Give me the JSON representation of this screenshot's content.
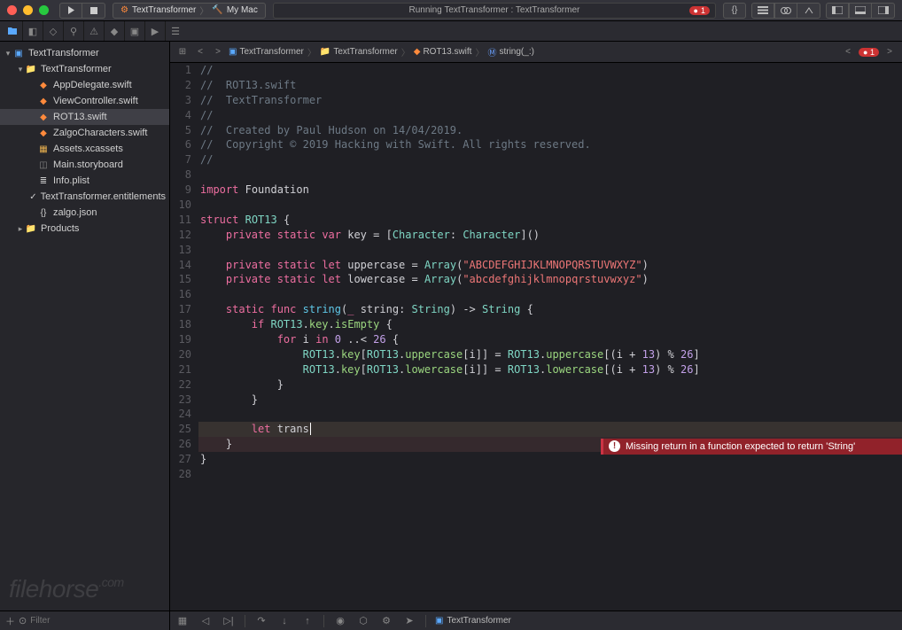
{
  "titlebar": {
    "scheme_target": "TextTransformer",
    "scheme_dest": "My Mac",
    "status_text": "Running TextTransformer : TextTransformer",
    "error_count": "1"
  },
  "navigator": {
    "items": [
      {
        "depth": 0,
        "disc": "▾",
        "icon": "proj",
        "label": "TextTransformer"
      },
      {
        "depth": 1,
        "disc": "▾",
        "icon": "folder",
        "label": "TextTransformer"
      },
      {
        "depth": 2,
        "disc": "",
        "icon": "swift",
        "label": "AppDelegate.swift"
      },
      {
        "depth": 2,
        "disc": "",
        "icon": "swift",
        "label": "ViewController.swift"
      },
      {
        "depth": 2,
        "disc": "",
        "icon": "swift",
        "label": "ROT13.swift",
        "selected": true
      },
      {
        "depth": 2,
        "disc": "",
        "icon": "swift",
        "label": "ZalgoCharacters.swift"
      },
      {
        "depth": 2,
        "disc": "",
        "icon": "asset",
        "label": "Assets.xcassets"
      },
      {
        "depth": 2,
        "disc": "",
        "icon": "sb",
        "label": "Main.storyboard"
      },
      {
        "depth": 2,
        "disc": "",
        "icon": "plist",
        "label": "Info.plist"
      },
      {
        "depth": 2,
        "disc": "",
        "icon": "ent",
        "label": "TextTransformer.entitlements"
      },
      {
        "depth": 2,
        "disc": "",
        "icon": "json",
        "label": "zalgo.json"
      },
      {
        "depth": 1,
        "disc": "▸",
        "icon": "folder",
        "label": "Products"
      }
    ]
  },
  "jumpbar": {
    "segments": [
      {
        "icon": "proj",
        "label": "TextTransformer"
      },
      {
        "icon": "folder",
        "label": "TextTransformer"
      },
      {
        "icon": "swift",
        "label": "ROT13.swift"
      },
      {
        "icon": "method",
        "label": "string(_:)"
      }
    ],
    "error_count": "1"
  },
  "code": {
    "lines": [
      {
        "n": 1,
        "t": "comment",
        "text": "//"
      },
      {
        "n": 2,
        "t": "comment",
        "text": "//  ROT13.swift"
      },
      {
        "n": 3,
        "t": "comment",
        "text": "//  TextTransformer"
      },
      {
        "n": 4,
        "t": "comment",
        "text": "//"
      },
      {
        "n": 5,
        "t": "comment",
        "text": "//  Created by Paul Hudson on 14/04/2019."
      },
      {
        "n": 6,
        "t": "comment",
        "text": "//  Copyright © 2019 Hacking with Swift. All rights reserved."
      },
      {
        "n": 7,
        "t": "comment",
        "text": "//"
      },
      {
        "n": 8,
        "t": "blank",
        "text": ""
      },
      {
        "n": 9,
        "t": "raw",
        "html": "<span class='cm-key'>import</span> <span class='cm-id'>Foundation</span>"
      },
      {
        "n": 10,
        "t": "blank",
        "text": ""
      },
      {
        "n": 11,
        "t": "raw",
        "html": "<span class='cm-key'>struct</span> <span class='cm-type'>ROT13</span> {"
      },
      {
        "n": 12,
        "t": "raw",
        "html": "    <span class='cm-key'>private</span> <span class='cm-key'>static</span> <span class='cm-key'>var</span> <span class='cm-id'>key</span> = [<span class='cm-type'>Character</span>: <span class='cm-type'>Character</span>]()"
      },
      {
        "n": 13,
        "t": "blank",
        "text": ""
      },
      {
        "n": 14,
        "t": "raw",
        "html": "    <span class='cm-key'>private</span> <span class='cm-key'>static</span> <span class='cm-key'>let</span> <span class='cm-id'>uppercase</span> = <span class='cm-type'>Array</span>(<span class='cm-str'>\"ABCDEFGHIJKLMNOPQRSTUVWXYZ\"</span>)"
      },
      {
        "n": 15,
        "t": "raw",
        "html": "    <span class='cm-key'>private</span> <span class='cm-key'>static</span> <span class='cm-key'>let</span> <span class='cm-id'>lowercase</span> = <span class='cm-type'>Array</span>(<span class='cm-str'>\"abcdefghijklmnopqrstuvwxyz\"</span>)"
      },
      {
        "n": 16,
        "t": "blank",
        "text": ""
      },
      {
        "n": 17,
        "t": "raw",
        "html": "    <span class='cm-key'>static</span> <span class='cm-key'>func</span> <span class='cm-func'>string</span>(<span class='cm-key'>_</span> <span class='cm-id'>string</span>: <span class='cm-type'>String</span>) -&gt; <span class='cm-type'>String</span> {"
      },
      {
        "n": 18,
        "t": "raw",
        "html": "        <span class='cm-key'>if</span> <span class='cm-type'>ROT13</span>.<span class='cm-prop'>key</span>.<span class='cm-prop'>isEmpty</span> {"
      },
      {
        "n": 19,
        "t": "raw",
        "html": "            <span class='cm-key'>for</span> <span class='cm-id'>i</span> <span class='cm-key'>in</span> <span class='cm-num'>0</span> ..&lt; <span class='cm-num'>26</span> {"
      },
      {
        "n": 20,
        "t": "raw",
        "html": "                <span class='cm-type'>ROT13</span>.<span class='cm-prop'>key</span>[<span class='cm-type'>ROT13</span>.<span class='cm-prop'>uppercase</span>[<span class='cm-id'>i</span>]] = <span class='cm-type'>ROT13</span>.<span class='cm-prop'>uppercase</span>[(<span class='cm-id'>i</span> + <span class='cm-num'>13</span>) % <span class='cm-num'>26</span>]"
      },
      {
        "n": 21,
        "t": "raw",
        "html": "                <span class='cm-type'>ROT13</span>.<span class='cm-prop'>key</span>[<span class='cm-type'>ROT13</span>.<span class='cm-prop'>lowercase</span>[<span class='cm-id'>i</span>]] = <span class='cm-type'>ROT13</span>.<span class='cm-prop'>lowercase</span>[(<span class='cm-id'>i</span> + <span class='cm-num'>13</span>) % <span class='cm-num'>26</span>]"
      },
      {
        "n": 22,
        "t": "raw",
        "html": "            }"
      },
      {
        "n": 23,
        "t": "raw",
        "html": "        }"
      },
      {
        "n": 24,
        "t": "blank",
        "text": ""
      },
      {
        "n": 25,
        "t": "raw",
        "hl": true,
        "html": "        <span class='cm-key'>let</span> <span class='cm-id'>trans</span><span class='cursor'></span>"
      },
      {
        "n": 26,
        "t": "raw",
        "hl2": true,
        "html": "    }"
      },
      {
        "n": 27,
        "t": "raw",
        "html": "}"
      },
      {
        "n": 28,
        "t": "blank",
        "text": ""
      }
    ]
  },
  "error": {
    "message": "Missing return in a function expected to return 'String'"
  },
  "bottombar": {
    "filter_placeholder": "Filter",
    "crumb": "TextTransformer"
  },
  "watermark": {
    "text": "filehorse",
    "suffix": ".com"
  }
}
